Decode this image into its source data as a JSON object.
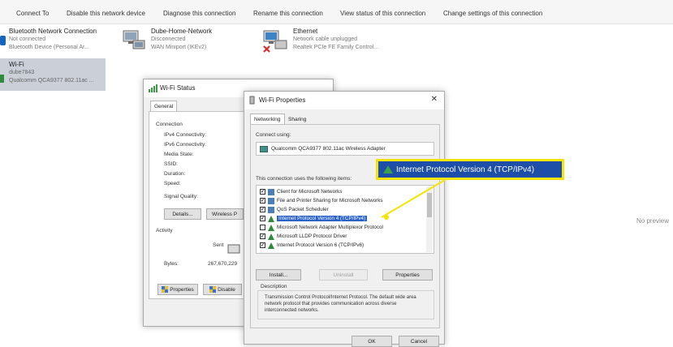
{
  "commandbar": {
    "connect_to": "Connect To",
    "disable": "Disable this network device",
    "diagnose": "Diagnose this connection",
    "rename": "Rename this connection",
    "view_status": "View status of this connection",
    "change_settings": "Change settings of this connection"
  },
  "connections": {
    "bluetooth": {
      "name": "Bluetooth Network Connection",
      "status": "Not connected",
      "device": "Bluetooth Device (Personal Ar..."
    },
    "dube": {
      "name": "Dube-Home-Network",
      "status": "Disconnected",
      "device": "WAN Miniport (IKEv2)"
    },
    "ethernet": {
      "name": "Ethernet",
      "status": "Network cable unplugged",
      "device": "Realtek PCIe FE Family Control..."
    },
    "wifi": {
      "name": "Wi-Fi",
      "status": "dube7843",
      "device": "Qualcomm QCA9377 802.11ac ..."
    }
  },
  "preview": {
    "no_preview": "No preview"
  },
  "status_dialog": {
    "title": "Wi-Fi Status",
    "tab_general": "General",
    "connection_label": "Connection",
    "ipv4": "IPv4 Connectivity:",
    "ipv6": "IPv6 Connectivity:",
    "media": "Media State:",
    "ssid": "SSID:",
    "duration": "Duration:",
    "speed": "Speed:",
    "signal": "Signal Quality:",
    "details_btn": "Details...",
    "wireless_btn": "Wireless P",
    "activity_label": "Activity",
    "sent": "Sent",
    "bytes_label": "Bytes:",
    "bytes_value": "267,670,229",
    "properties_btn": "Properties",
    "disable_btn": "Disable"
  },
  "props_dialog": {
    "title": "Wi-Fi Properties",
    "tab_networking": "Networking",
    "tab_sharing": "Sharing",
    "connect_using": "Connect using:",
    "adapter": "Qualcomm QCA9377 802.11ac Wireless Adapter",
    "items_label": "This connection uses the following items:",
    "items": [
      {
        "label": "Client for Microsoft Networks",
        "checked": true
      },
      {
        "label": "File and Printer Sharing for Microsoft Networks",
        "checked": true
      },
      {
        "label": "QoS Packet Scheduler",
        "checked": true
      },
      {
        "label": "Internet Protocol Version 4 (TCP/IPv4)",
        "checked": true,
        "selected": true
      },
      {
        "label": "Microsoft Network Adapter Multiplexor Protocol",
        "checked": false
      },
      {
        "label": "Microsoft LLDP Protocol Driver",
        "checked": true
      },
      {
        "label": "Internet Protocol Version 6 (TCP/IPv6)",
        "checked": true
      }
    ],
    "install_btn": "Install...",
    "uninstall_btn": "Uninstall",
    "properties_btn": "Properties",
    "description_label": "Description",
    "description_text": "Transmission Control Protocol/Internet Protocol. The default wide area network protocol that provides communication across diverse interconnected networks.",
    "ok_btn": "OK",
    "cancel_btn": "Cancel"
  },
  "callout": {
    "label": "Internet Protocol Version 4 (TCP/IPv4)"
  },
  "colors": {
    "highlight": "#2a62c9",
    "callout_bg": "#1d4fa8",
    "callout_border": "#f5e400",
    "selection": "#cbd0d8"
  }
}
